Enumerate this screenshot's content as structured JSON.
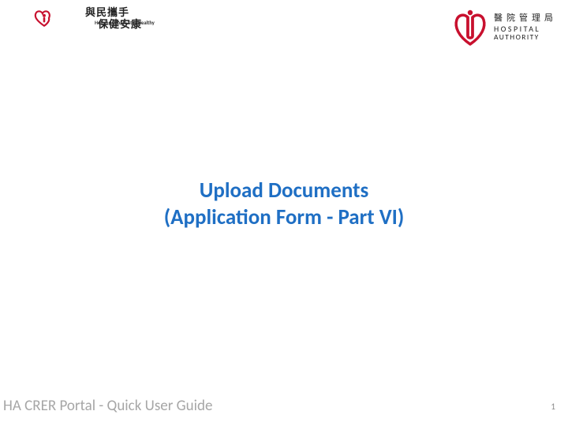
{
  "logoLeft": {
    "chinese1": "與民攜手",
    "chinese2": "保健安康",
    "english": "Helping People Stay Healthy"
  },
  "logoRight": {
    "chinese": "醫院管理局",
    "english1": "HOSPITAL",
    "english2": "AUTHORITY"
  },
  "title": {
    "line1": "Upload Documents",
    "line2": "(Application Form - Part VI)"
  },
  "footer": "HA CRER Portal - Quick User Guide",
  "pageNumber": "1"
}
